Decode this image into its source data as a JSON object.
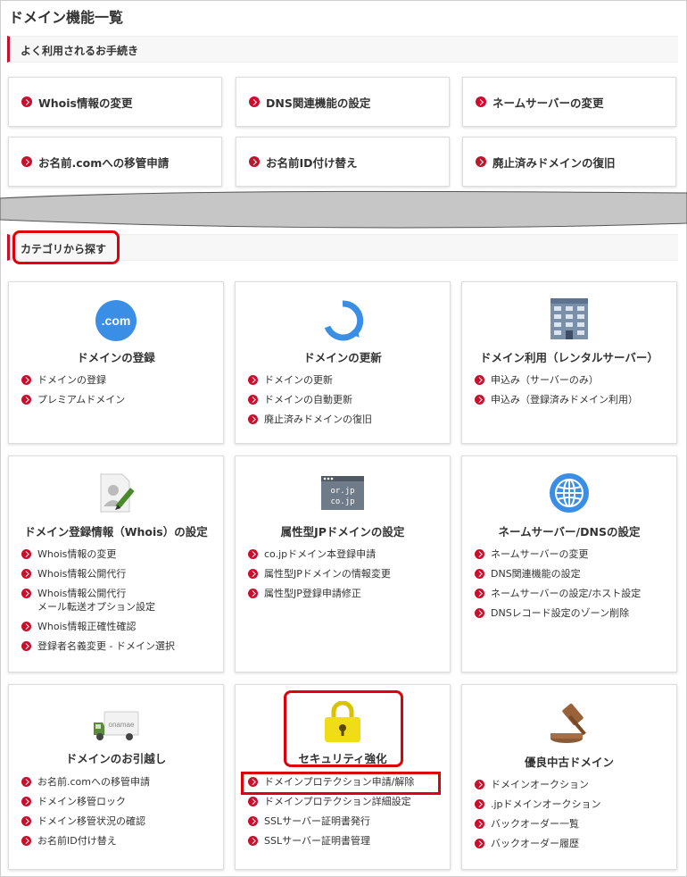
{
  "page_title": "ドメイン機能一覧",
  "quick_section_title": "よく利用されるお手続き",
  "quick_links": [
    {
      "label": "Whois情報の変更"
    },
    {
      "label": "DNS関連機能の設定"
    },
    {
      "label": "ネームサーバーの変更"
    },
    {
      "label": "お名前.comへの移管申請"
    },
    {
      "label": "お名前ID付け替え"
    },
    {
      "label": "廃止済みドメインの復旧"
    }
  ],
  "category_section_title": "カテゴリから探す",
  "cards": [
    {
      "title": "ドメインの登録",
      "icon": "dot-com-icon",
      "icon_text": ".com",
      "links": [
        "ドメインの登録",
        "プレミアムドメイン"
      ]
    },
    {
      "title": "ドメインの更新",
      "icon": "refresh-icon",
      "links": [
        "ドメインの更新",
        "ドメインの自動更新",
        "廃止済みドメインの復旧"
      ]
    },
    {
      "title": "ドメイン利用（レンタルサーバー）",
      "icon": "building-icon",
      "links": [
        "申込み（サーバーのみ）",
        "申込み（登録済みドメイン利用）"
      ]
    },
    {
      "title": "ドメイン登録情報（Whois）の設定",
      "icon": "profile-edit-icon",
      "links": [
        "Whois情報の変更",
        "Whois情報公開代行",
        "Whois情報公開代行\nメール転送オプション設定",
        "Whois情報正確性確認",
        "登録者名義変更 - ドメイン選択"
      ]
    },
    {
      "title": "属性型JPドメインの設定",
      "icon": "jp-domain-icon",
      "icon_text_1": "or.jp",
      "icon_text_2": "co.jp",
      "links": [
        "co.jpドメイン本登録申請",
        "属性型JPドメインの情報変更",
        "属性型JP登録申請修正"
      ]
    },
    {
      "title": "ネームサーバー/DNSの設定",
      "icon": "globe-icon",
      "links": [
        "ネームサーバーの変更",
        "DNS関連機能の設定",
        "ネームサーバーの設定/ホスト設定",
        "DNSレコード設定のゾーン削除"
      ]
    },
    {
      "title": "ドメインのお引越し",
      "icon": "truck-icon",
      "icon_text": "onamae",
      "links": [
        "お名前.comへの移管申請",
        "ドメイン移管ロック",
        "ドメイン移管状況の確認",
        "お名前ID付け替え"
      ]
    },
    {
      "title": "セキュリティ強化",
      "icon": "padlock-icon",
      "links": [
        "ドメインプロテクション申請/解除",
        "ドメインプロテクション詳細設定",
        "SSLサーバー証明書発行",
        "SSLサーバー証明書管理"
      ]
    },
    {
      "title": "優良中古ドメイン",
      "icon": "gavel-icon",
      "links": [
        "ドメインオークション",
        ".jpドメインオークション",
        "バックオーダー一覧",
        "バックオーダー履歴"
      ]
    }
  ],
  "colors": {
    "accent": "#c8102e",
    "highlight": "#e0000b",
    "icon_blue": "#3a8ee6"
  }
}
